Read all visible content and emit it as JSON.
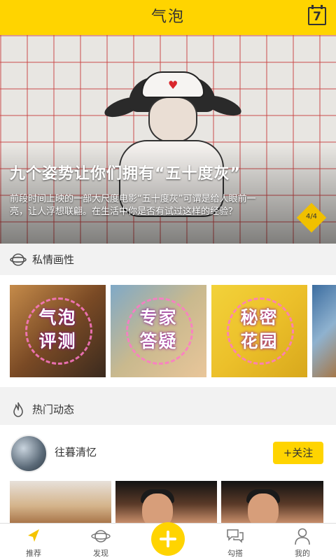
{
  "app": {
    "title": "气泡",
    "calendar_day": "7",
    "accent": "#ffd400"
  },
  "banner": {
    "title": "九个姿势让你们拥有“五十度灰”",
    "description": "前段时间上映的一部大尺度电影“五十度灰”可谓是给人眼前一亮，让人浮想联翩。在生活中你是否有试过这样的经验？",
    "page_indicator": "4/4"
  },
  "section_private": {
    "label": "私情画性",
    "icon": "planet-icon"
  },
  "categories": [
    {
      "label": "气泡\n评测"
    },
    {
      "label": "专家\n答疑"
    },
    {
      "label": "秘密\n花园"
    }
  ],
  "section_hot": {
    "label": "热门动态",
    "icon": "flame-icon"
  },
  "feed": {
    "username": "往暮清忆",
    "follow_label": "+关注"
  },
  "nav": [
    {
      "label": "推荐",
      "icon": "compass-arrow-icon"
    },
    {
      "label": "发现",
      "icon": "planet-icon"
    },
    {
      "label": "",
      "icon": "plus-icon"
    },
    {
      "label": "勾搭",
      "icon": "chat-bubbles-icon"
    },
    {
      "label": "我的",
      "icon": "person-icon"
    }
  ]
}
